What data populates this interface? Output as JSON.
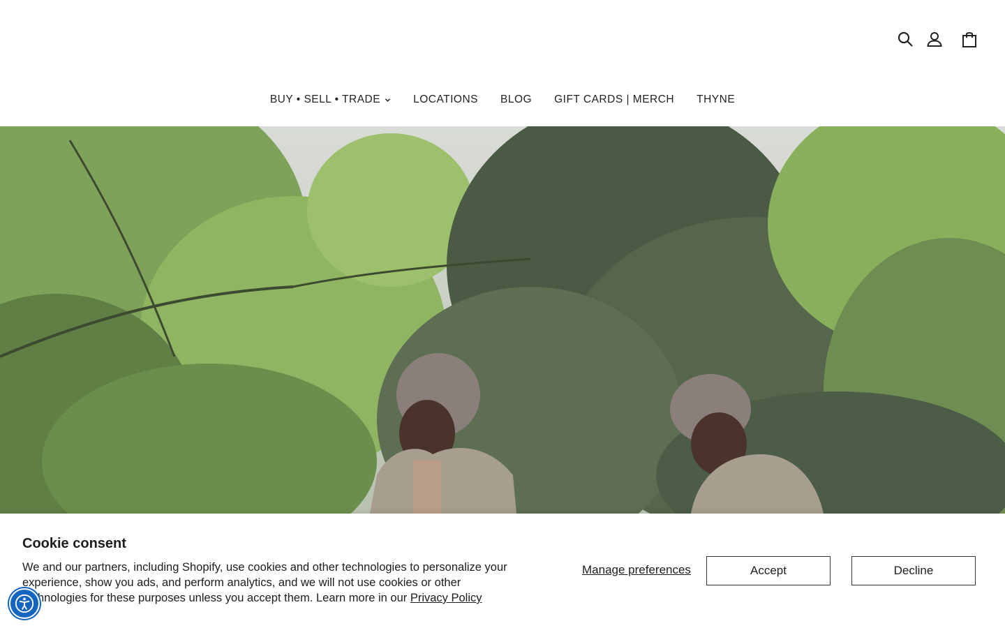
{
  "header": {
    "icons": [
      "search-icon",
      "account-icon",
      "cart-icon"
    ]
  },
  "nav": {
    "items": [
      {
        "label": "BUY • SELL • TRADE",
        "has_dropdown": true
      },
      {
        "label": "LOCATIONS",
        "has_dropdown": false
      },
      {
        "label": "BLOG",
        "has_dropdown": false
      },
      {
        "label": "GIFT CARDS | MERCH",
        "has_dropdown": false
      },
      {
        "label": "THYNE",
        "has_dropdown": false
      }
    ]
  },
  "cookie": {
    "title": "Cookie consent",
    "text_before_link": "We and our partners, including Shopify, use cookies and other technologies to personalize your experience, show you ads, and perform analytics, and we will not use cookies or other technologies for these purposes unless you accept them. Learn more in our ",
    "link_label": "Privacy Policy",
    "manage_label": "Manage preferences",
    "accept_label": "Accept",
    "decline_label": "Decline"
  },
  "accessibility": {
    "icon": "accessibility-icon",
    "color": "#1565c0"
  }
}
